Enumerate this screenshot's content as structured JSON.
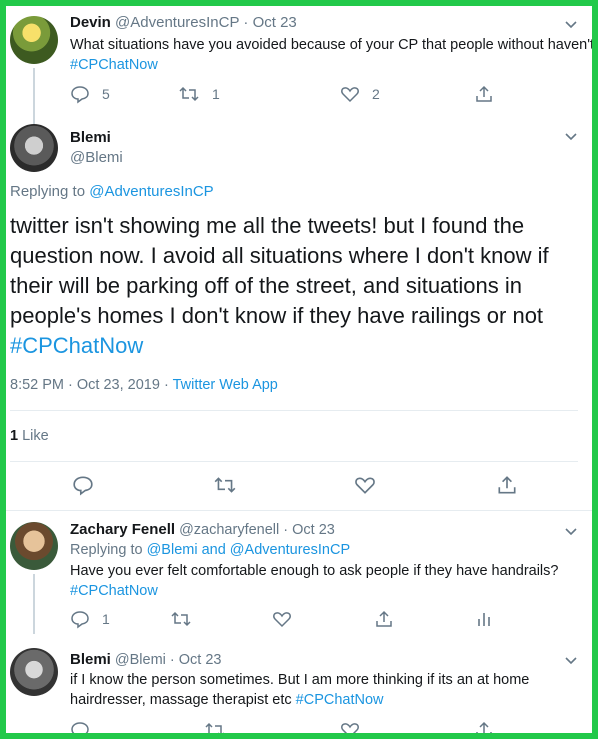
{
  "tweet1": {
    "name": "Devin",
    "handle": "@AdventuresInCP",
    "date": "Oct 23",
    "text": "What situations have you avoided because of your CP that people without haven't?",
    "hashtag": "#CPChatNow",
    "replies": "5",
    "retweets": "1",
    "likes": "2"
  },
  "main": {
    "name": "Blemi",
    "handle": "@Blemi",
    "replying_label": "Replying to",
    "replying_to": "@AdventuresInCP",
    "text": "twitter isn't showing me all the tweets! but I found the question now. I avoid all situations where I don't know if their will be parking off of the street, and situations in people's homes I don't know if they have railings or not",
    "hashtag": "#CPChatNow",
    "timestamp": "8:52 PM · Oct 23, 2019 ·",
    "source": "Twitter Web App",
    "like_count": "1",
    "like_label": "Like"
  },
  "reply1": {
    "name": "Zachary Fenell",
    "handle": "@zacharyfenell",
    "date": "Oct 23",
    "replying_label": "Replying to",
    "replying_to": "@Blemi and @AdventuresInCP",
    "text": "Have you ever felt comfortable enough to ask people if they have handrails?",
    "hashtag": "#CPChatNow",
    "replies": "1"
  },
  "reply2": {
    "name": "Blemi",
    "handle": "@Blemi",
    "date": "Oct 23",
    "text_line1": "if I know the person sometimes. But I am more thinking if its an at home",
    "text_line2": "hairdresser, massage therapist etc",
    "hashtag": "#CPChatNow"
  },
  "icons": [
    "reply-icon",
    "retweet-icon",
    "like-icon",
    "share-icon",
    "analytics-icon",
    "chevron-down-icon"
  ],
  "colors": {
    "frame": "#22c94a",
    "link": "#1b95e0",
    "muted": "#657786",
    "text": "#14171a"
  }
}
